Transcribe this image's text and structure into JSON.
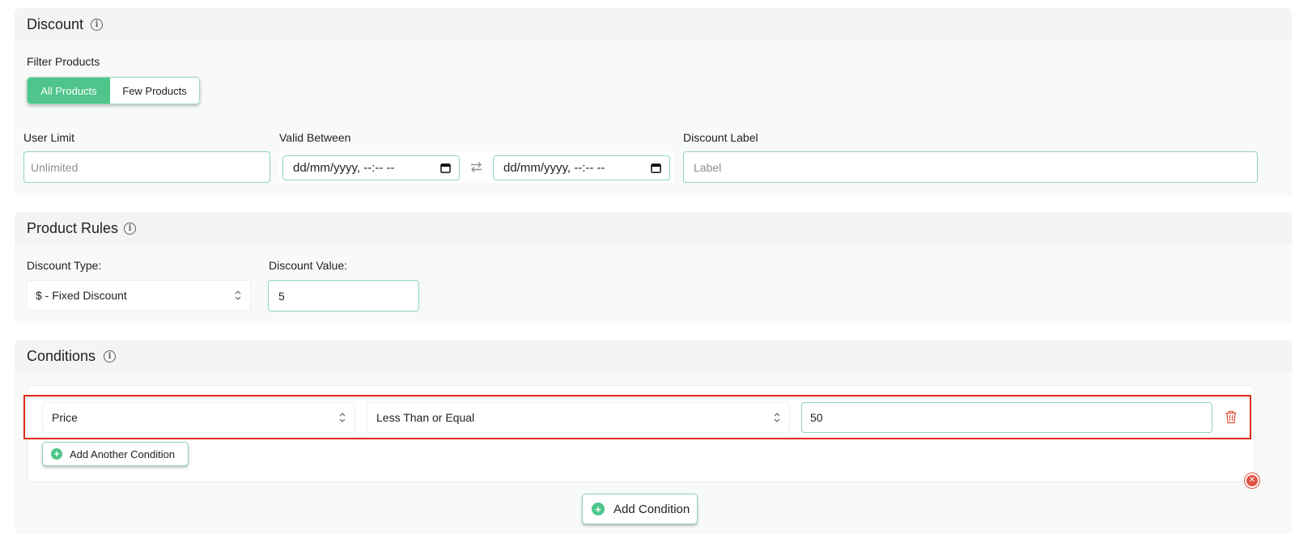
{
  "discount": {
    "title": "Discount",
    "filter_label": "Filter Products",
    "filter_options": [
      "All Products",
      "Few Products"
    ],
    "selected_filter": "All Products",
    "user_limit_label": "User Limit",
    "user_limit_placeholder": "Unlimited",
    "valid_between_label": "Valid Between",
    "date_start_placeholder": "dd/mm/yyyy, --:-- --",
    "date_end_placeholder": "dd/mm/yyyy, --:-- --",
    "discount_label_label": "Discount Label",
    "discount_label_placeholder": "Label"
  },
  "product_rules": {
    "title": "Product Rules",
    "discount_type_label": "Discount Type:",
    "discount_type_value": "$ - Fixed Discount",
    "discount_value_label": "Discount Value:",
    "discount_value": "5"
  },
  "conditions": {
    "title": "Conditions",
    "rows": [
      {
        "field": "Price",
        "operator": "Less Than or Equal",
        "value": "50"
      }
    ],
    "add_another_label": "Add Another Condition",
    "add_condition_label": "Add Condition"
  },
  "colors": {
    "accent_green": "#4fc58b",
    "input_border": "#8fd6b4",
    "highlight_red": "#e02b1a",
    "danger_red": "#e0533f"
  },
  "icons": [
    "info-icon",
    "swap-arrows-icon",
    "calendar-icon",
    "chevron-updown-icon",
    "trash-icon",
    "plus-circle-icon",
    "close-circle-icon"
  ]
}
